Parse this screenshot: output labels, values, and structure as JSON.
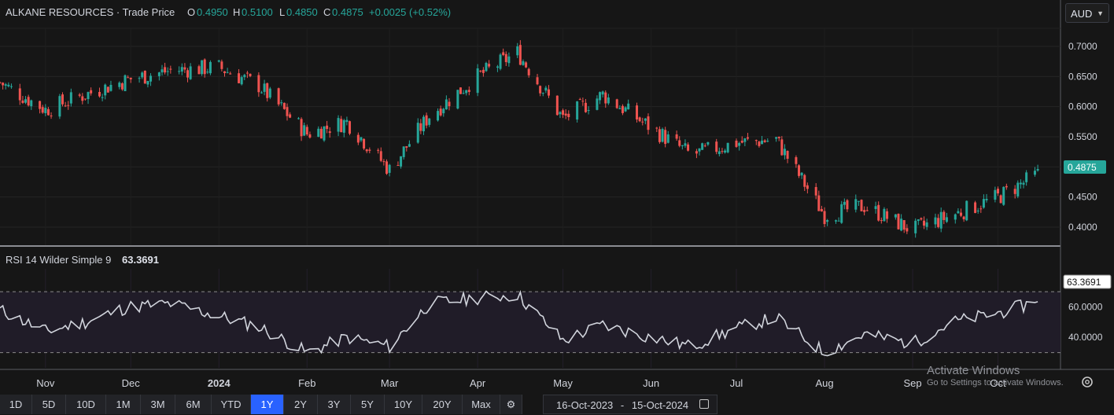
{
  "header": {
    "title": "ALKANE RESOURCES · Trade Price",
    "o_label": "O",
    "o_value": "0.4950",
    "h_label": "H",
    "h_value": "0.5100",
    "l_label": "L",
    "l_value": "0.4850",
    "c_label": "C",
    "c_value": "0.4875",
    "change": "+0.0025 (+0.52%)"
  },
  "currency": {
    "value": "AUD"
  },
  "rsi": {
    "label": "RSI 14 Wilder Simple 9",
    "value": "63.3691"
  },
  "price_tag": "0.4875",
  "ranges": [
    "1D",
    "5D",
    "10D",
    "1M",
    "3M",
    "6M",
    "YTD",
    "1Y",
    "2Y",
    "3Y",
    "5Y",
    "10Y",
    "20Y",
    "Max"
  ],
  "active_range": "1Y",
  "date_range": {
    "from": "16-Oct-2023",
    "sep": "-",
    "to": "15-Oct-2024"
  },
  "watermark": {
    "line1": "Activate Windows",
    "line2": "Go to Settings to activate Windows."
  },
  "colors": {
    "up": "#26a69a",
    "down": "#ef5350",
    "background": "#161616",
    "rsi": "#d1d4dc",
    "active": "#2962ff"
  },
  "chart_data": [
    {
      "type": "candlestick",
      "title": "ALKANE RESOURCES · Trade Price",
      "ylim": [
        0.37,
        0.73
      ],
      "yticks": [
        "0.4000",
        "0.4500",
        "0.5000",
        "0.5500",
        "0.6000",
        "0.6500",
        "0.7000"
      ],
      "xticks": [
        "Nov",
        "Dec",
        "2024",
        "Feb",
        "Mar",
        "Apr",
        "May",
        "Jun",
        "Jul",
        "Aug",
        "Sep",
        "Oct"
      ],
      "x": [
        "2023-10-16",
        "2023-11-01",
        "2023-11-15",
        "2023-11-30",
        "2023-12-15",
        "2024-01-01",
        "2024-01-15",
        "2024-02-01",
        "2024-02-15",
        "2024-03-01",
        "2024-03-15",
        "2024-04-01",
        "2024-04-15",
        "2024-05-01",
        "2024-05-15",
        "2024-06-01",
        "2024-06-15",
        "2024-07-01",
        "2024-07-15",
        "2024-08-01",
        "2024-08-15",
        "2024-09-01",
        "2024-09-15",
        "2024-10-01",
        "2024-10-15"
      ],
      "close": [
        0.64,
        0.595,
        0.62,
        0.645,
        0.66,
        0.665,
        0.635,
        0.555,
        0.575,
        0.495,
        0.585,
        0.65,
        0.69,
        0.58,
        0.62,
        0.565,
        0.52,
        0.54,
        0.545,
        0.42,
        0.435,
        0.395,
        0.42,
        0.45,
        0.4875
      ],
      "ohlc_last": {
        "open": 0.495,
        "high": 0.51,
        "low": 0.485,
        "close": 0.4875
      }
    },
    {
      "type": "line",
      "name": "RSI 14 Wilder Simple 9",
      "ylim": [
        20,
        85
      ],
      "yticks": [
        "40.0000",
        "60.0000"
      ],
      "guides": [
        30,
        70
      ],
      "x": [
        "2023-10-16",
        "2023-11-01",
        "2023-11-15",
        "2023-11-30",
        "2023-12-15",
        "2024-01-01",
        "2024-01-15",
        "2024-02-01",
        "2024-02-15",
        "2024-03-01",
        "2024-03-15",
        "2024-04-01",
        "2024-04-15",
        "2024-05-01",
        "2024-05-15",
        "2024-06-01",
        "2024-06-15",
        "2024-07-01",
        "2024-07-15",
        "2024-08-01",
        "2024-08-15",
        "2024-09-01",
        "2024-09-15",
        "2024-10-01",
        "2024-10-15"
      ],
      "values": [
        58,
        44,
        50,
        60,
        62,
        54,
        47,
        30,
        40,
        34,
        62,
        66,
        68,
        38,
        48,
        40,
        34,
        46,
        53,
        30,
        42,
        36,
        50,
        56,
        63.37
      ]
    }
  ]
}
